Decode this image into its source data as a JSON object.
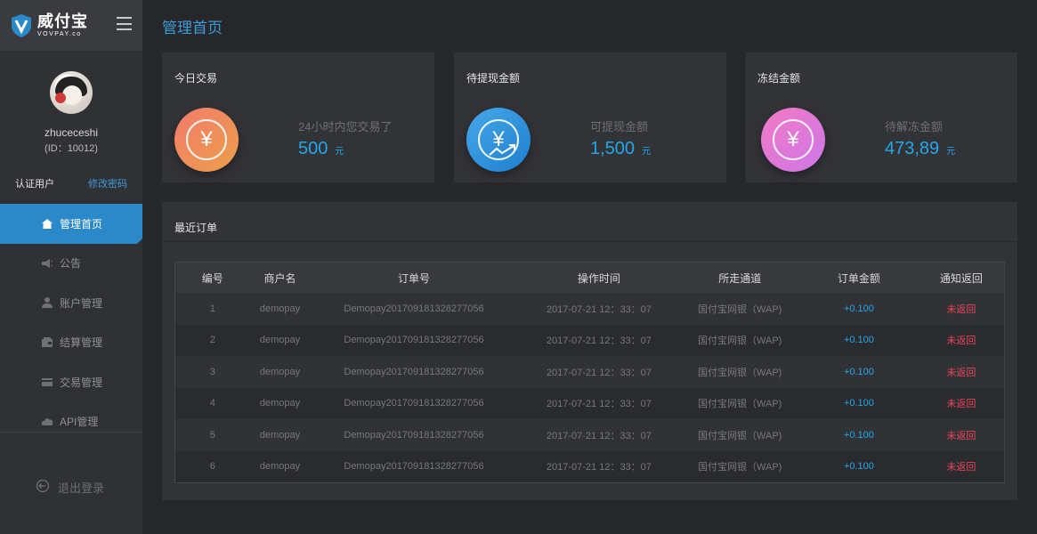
{
  "brand": {
    "name": "威付宝",
    "sub": "VOVPAY.co"
  },
  "user": {
    "name": "zhuceceshi",
    "id": "(ID：10012)"
  },
  "account": {
    "status_label": "认证用户",
    "change_password": "修改密码"
  },
  "nav": [
    {
      "label": "管理首页",
      "icon": "home-icon"
    },
    {
      "label": "公告",
      "icon": "megaphone-icon"
    },
    {
      "label": "账户管理",
      "icon": "user-icon"
    },
    {
      "label": "结算管理",
      "icon": "wallet-icon"
    },
    {
      "label": "交易管理",
      "icon": "card-icon"
    },
    {
      "label": "API管理",
      "icon": "cloud-icon"
    }
  ],
  "logout": "退出登录",
  "page_title": "管理首页",
  "cards": [
    {
      "title": "今日交易",
      "sub": "24小时内您交易了",
      "value": "500",
      "unit": "元",
      "color": "#f27b6c"
    },
    {
      "title": "待提现金额",
      "sub": "可提现金额",
      "value": "1,500",
      "unit": "元",
      "color": "#2c89c9"
    },
    {
      "title": "冻结金额",
      "sub": "待解冻金额",
      "value": "473,89",
      "unit": "元",
      "color": "#e27ad0"
    }
  ],
  "orders": {
    "title": "最近订单",
    "headers": [
      "编号",
      "商户名",
      "订单号",
      "操作时间",
      "所走通道",
      "订单金额",
      "通知返回"
    ],
    "rows": [
      [
        "1",
        "demopay",
        "Demopay201709181328277056",
        "2017-07-21  12：33：07",
        "国付宝网银（WAP)",
        "+0.100",
        "未返回"
      ],
      [
        "2",
        "demopay",
        "Demopay201709181328277056",
        "2017-07-21  12：33：07",
        "国付宝网银（WAP)",
        "+0.100",
        "未返回"
      ],
      [
        "3",
        "demopay",
        "Demopay201709181328277056",
        "2017-07-21  12：33：07",
        "国付宝网银（WAP)",
        "+0.100",
        "未返回"
      ],
      [
        "4",
        "demopay",
        "Demopay201709181328277056",
        "2017-07-21  12：33：07",
        "国付宝网银（WAP)",
        "+0.100",
        "未返回"
      ],
      [
        "5",
        "demopay",
        "Demopay201709181328277056",
        "2017-07-21  12：33：07",
        "国付宝网银（WAP)",
        "+0.100",
        "未返回"
      ],
      [
        "6",
        "demopay",
        "Demopay201709181328277056",
        "2017-07-21  12：33：07",
        "国付宝网银（WAP)",
        "+0.100",
        "未返回"
      ]
    ]
  },
  "colors": {
    "accent": "#2c89c9",
    "amount": "#23a7e8",
    "status_error": "#e8455a"
  }
}
